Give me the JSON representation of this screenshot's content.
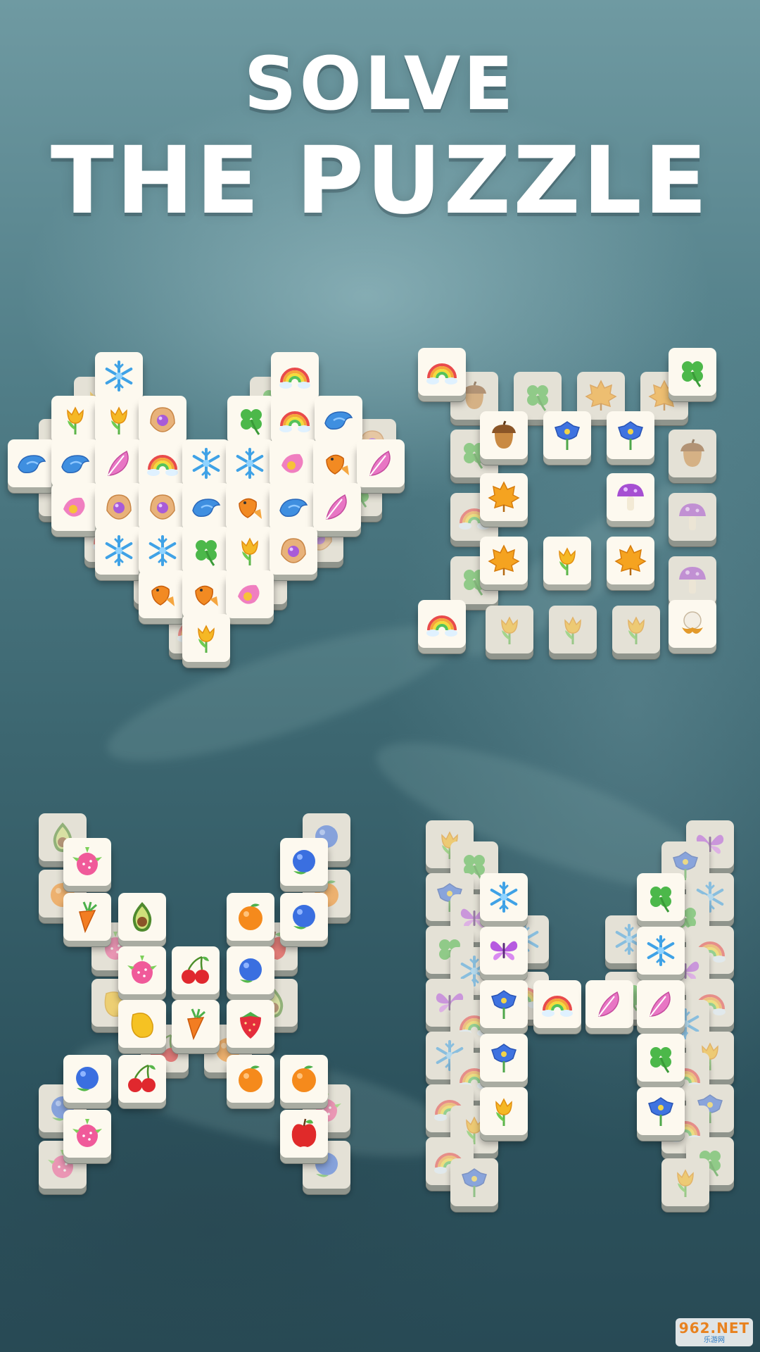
{
  "title": {
    "line1": "SOLVE",
    "line2": "THE PUZZLE"
  },
  "watermark": {
    "brand": "962.NET",
    "subtitle": "乐游网"
  },
  "tile_colors": {
    "face": "#fdf9ef",
    "side": "#a9aca2",
    "back": "#e4e1d6"
  },
  "boards": [
    {
      "name": "heart",
      "back_tiles": [
        [
          "flower-tulip-icon"
        ],
        [
          "clover-icon"
        ],
        [
          "rainbow-icon"
        ],
        [
          "shell-pearl-icon"
        ]
      ],
      "tiles": [
        "snowflake-icon",
        "rainbow-icon",
        "tulip-icon",
        "tulip-icon",
        "shell-pearl-icon",
        "clover-icon",
        "rainbow-icon",
        "bird-blue-icon",
        "bird-blue-icon",
        "bird-blue-icon",
        "feather-pink-icon",
        "rainbow-icon",
        "snowflake-icon",
        "snowflake-icon",
        "petal-pink-icon",
        "goldfish-icon",
        "feather-pink-icon",
        "petal-pink-icon",
        "shell-pearl-icon",
        "shell-pearl-icon",
        "bird-blue-icon",
        "goldfish-icon",
        "bird-blue-icon",
        "feather-pink-icon",
        "snowflake-icon",
        "snowflake-icon",
        "clover-icon",
        "tulip-icon",
        "shell-pearl-icon",
        "goldfish-icon",
        "goldfish-icon",
        "petal-pink-icon",
        "tulip-icon"
      ]
    },
    {
      "name": "square",
      "tiles": [
        "rainbow-icon",
        "clover-icon",
        "acorn-icon",
        "bellflower-icon",
        "bellflower-icon",
        "maple-leaf-icon",
        "mushroom-icon",
        "maple-leaf-icon",
        "tulip-icon",
        "maple-leaf-icon",
        "rainbow-icon",
        "cotton-icon"
      ]
    },
    {
      "name": "fruit-x",
      "tiles": [
        "dragonfruit-icon",
        "blueberry-icon",
        "carrot-icon",
        "avocado-icon",
        "orange-icon",
        "blueberry-icon",
        "dragonfruit-icon",
        "cherry-icon",
        "blueberry-icon",
        "mango-icon",
        "carrot-icon",
        "strawberry-icon",
        "blueberry-icon",
        "cherry-icon",
        "orange-icon",
        "orange-icon",
        "dragonfruit-icon",
        "apple-icon"
      ]
    },
    {
      "name": "h-shape",
      "tiles": [
        "snowflake-icon",
        "clover-icon",
        "butterfly-icon",
        "snowflake-icon",
        "bellflower-icon",
        "rainbow-icon",
        "feather-pink-icon",
        "feather-pink-icon",
        "bellflower-icon",
        "clover-icon",
        "tulip-icon",
        "bellflower-icon"
      ]
    }
  ]
}
